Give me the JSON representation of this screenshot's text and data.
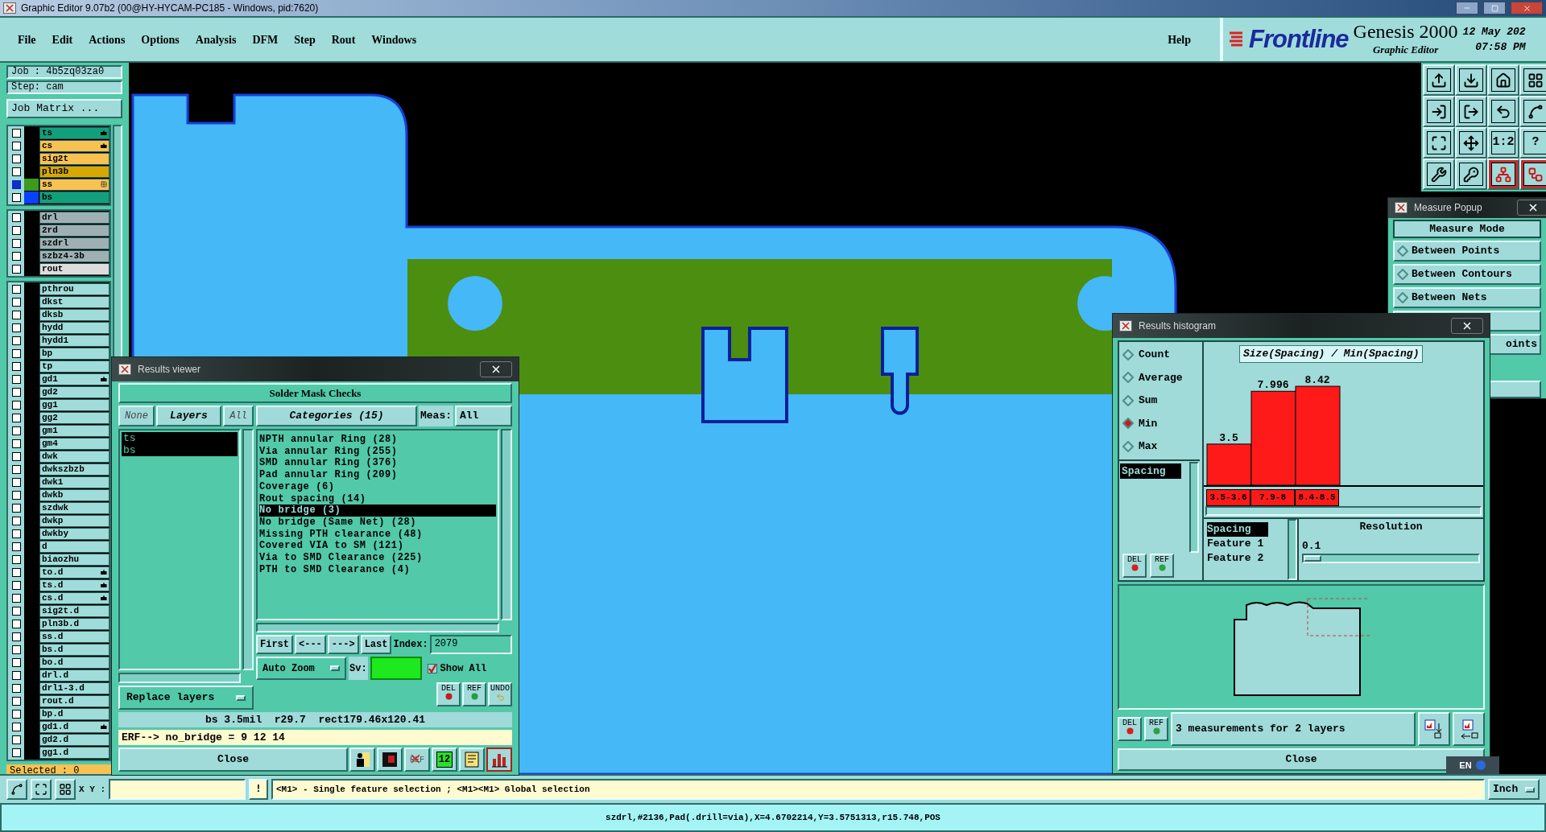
{
  "window": {
    "title": "Graphic Editor 9.07b2 (00@HY-HYCAM-PC185 - Windows, pid:7620)"
  },
  "menu": [
    {
      "label": "File"
    },
    {
      "label": "Edit"
    },
    {
      "label": "Actions"
    },
    {
      "label": "Options"
    },
    {
      "label": "Analysis"
    },
    {
      "label": "DFM"
    },
    {
      "label": "Step"
    },
    {
      "label": "Rout"
    },
    {
      "label": "Windows"
    }
  ],
  "help": "Help",
  "brand": {
    "logo": "Frontline",
    "product": "Genesis 2000",
    "subtitle": "Graphic Editor",
    "date": "12 May 202",
    "time": "07:58 PM"
  },
  "job": {
    "job": "Job : 4b5zq03za0",
    "step": "Step: cam",
    "matrix": "Job Matrix ..."
  },
  "layer_groups": [
    [
      {
        "name": "ts",
        "color": "#12a07c",
        "highlighted": false,
        "edit_mark": true
      },
      {
        "name": "cs",
        "color": "#f7c252",
        "highlighted": false,
        "edit_mark": true
      },
      {
        "name": "sig2t",
        "color": "#f7c252",
        "highlighted": false
      },
      {
        "name": "pln3b",
        "color": "#d9a800",
        "highlighted": false
      },
      {
        "name": "ss",
        "color": "#f7c252",
        "highlighted": true,
        "swatch": {
          "color": "#3c9a1c"
        },
        "grid_mark": true
      },
      {
        "name": "bs",
        "color": "#12a07c",
        "highlighted": false,
        "swatch": {
          "color": "#0a40ff"
        }
      }
    ],
    [
      {
        "name": "drl",
        "color": "#9eb0b4",
        "highlighted": false
      },
      {
        "name": "2rd",
        "color": "#9eb0b4",
        "highlighted": false
      },
      {
        "name": "szdrl",
        "color": "#9eb0b4",
        "highlighted": false
      },
      {
        "name": "szbz4-3b",
        "color": "#9eb0b4",
        "highlighted": false
      },
      {
        "name": "rout",
        "color": "#dcdcdc",
        "highlighted": false
      }
    ],
    [
      {
        "name": "pthrou",
        "color": "#9fdcda",
        "highlighted": false
      },
      {
        "name": "dkst",
        "color": "#9fdcda",
        "highlighted": false
      },
      {
        "name": "dksb",
        "color": "#9fdcda",
        "highlighted": false
      },
      {
        "name": "hydd",
        "color": "#9fdcda",
        "highlighted": false
      },
      {
        "name": "hydd1",
        "color": "#9fdcda",
        "highlighted": false
      },
      {
        "name": "bp",
        "color": "#9fdcda",
        "highlighted": false
      },
      {
        "name": "tp",
        "color": "#9fdcda",
        "highlighted": false
      },
      {
        "name": "gd1",
        "color": "#9fdcda",
        "highlighted": false,
        "edit_mark": true
      },
      {
        "name": "gd2",
        "color": "#9fdcda",
        "highlighted": false
      },
      {
        "name": "gg1",
        "color": "#9fdcda",
        "highlighted": false
      },
      {
        "name": "gg2",
        "color": "#9fdcda",
        "highlighted": false
      },
      {
        "name": "gm1",
        "color": "#9fdcda",
        "highlighted": false
      },
      {
        "name": "gm4",
        "color": "#9fdcda",
        "highlighted": false
      },
      {
        "name": "dwk",
        "color": "#9fdcda",
        "highlighted": false
      },
      {
        "name": "dwkszbzb",
        "color": "#9fdcda",
        "highlighted": false
      },
      {
        "name": "dwk1",
        "color": "#9fdcda",
        "highlighted": false
      },
      {
        "name": "dwkb",
        "color": "#9fdcda",
        "highlighted": false
      },
      {
        "name": "szdwk",
        "color": "#9fdcda",
        "highlighted": false
      },
      {
        "name": "dwkp",
        "color": "#9fdcda",
        "highlighted": false
      },
      {
        "name": "dwkby",
        "color": "#9fdcda",
        "highlighted": false
      },
      {
        "name": "d",
        "color": "#9fdcda",
        "highlighted": false
      },
      {
        "name": "biaozhu",
        "color": "#9fdcda",
        "highlighted": false
      },
      {
        "name": "to.d",
        "color": "#9fdcda",
        "highlighted": false,
        "edit_mark": true
      },
      {
        "name": "ts.d",
        "color": "#9fdcda",
        "highlighted": false,
        "edit_mark": true
      },
      {
        "name": "cs.d",
        "color": "#9fdcda",
        "highlighted": false,
        "edit_mark": true
      },
      {
        "name": "sig2t.d",
        "color": "#9fdcda",
        "highlighted": false
      },
      {
        "name": "pln3b.d",
        "color": "#9fdcda",
        "highlighted": false
      },
      {
        "name": "ss.d",
        "color": "#9fdcda",
        "highlighted": false
      },
      {
        "name": "bs.d",
        "color": "#9fdcda",
        "highlighted": false
      },
      {
        "name": "bo.d",
        "color": "#9fdcda",
        "highlighted": false
      },
      {
        "name": "drl.d",
        "color": "#9fdcda",
        "highlighted": false
      },
      {
        "name": "drl1-3.d",
        "color": "#9fdcda",
        "highlighted": false
      },
      {
        "name": "rout.d",
        "color": "#9fdcda",
        "highlighted": false
      },
      {
        "name": "bp.d",
        "color": "#9fdcda",
        "highlighted": false
      },
      {
        "name": "gd1.d",
        "color": "#9fdcda",
        "highlighted": false,
        "edit_mark": true
      },
      {
        "name": "gd2.d",
        "color": "#9fdcda",
        "highlighted": false
      },
      {
        "name": "gg1.d",
        "color": "#9fdcda",
        "highlighted": false
      }
    ]
  ],
  "selected_count": "Selected : 0",
  "toolbar": [
    {
      "selected": false
    },
    {
      "selected": false
    },
    {
      "selected": false
    },
    {
      "selected": false
    },
    {
      "selected": false
    },
    {
      "selected": false
    },
    {
      "selected": false
    },
    {
      "selected": false
    },
    {
      "selected": false
    },
    {
      "selected": false
    },
    {
      "selected": false,
      "label": "1:2"
    },
    {
      "selected": false,
      "label": "?"
    },
    {
      "selected": false
    },
    {
      "selected": false
    },
    {
      "selected": true
    },
    {
      "selected": true
    }
  ],
  "results_viewer": {
    "title": "Results viewer",
    "heading": "Solder Mask Checks",
    "none": "None",
    "layers_header": "Layers",
    "all": "All",
    "layers": [
      {
        "name": "ts",
        "selected": true
      },
      {
        "name": "bs",
        "selected": true
      }
    ],
    "categories_header": "Categories (15)",
    "meas_label": "Meas:",
    "meas_value": "All",
    "categories": [
      {
        "label": "NPTH annular Ring (28)",
        "selected": false
      },
      {
        "label": "Via annular Ring (255)",
        "selected": false
      },
      {
        "label": "SMD annular Ring (376)",
        "selected": false
      },
      {
        "label": "Pad annular Ring (209)",
        "selected": false
      },
      {
        "label": "Coverage (6)",
        "selected": false
      },
      {
        "label": "Rout spacing (14)",
        "selected": false
      },
      {
        "label": "No bridge (3)",
        "selected": true
      },
      {
        "label": "No bridge (Same Net) (28)",
        "selected": false
      },
      {
        "label": "Missing PTH clearance (48)",
        "selected": false
      },
      {
        "label": "Covered VIA to SM (121)",
        "selected": false
      },
      {
        "label": "Via to SMD Clearance (225)",
        "selected": false
      },
      {
        "label": "PTH to SMD Clearance (4)",
        "selected": false
      }
    ],
    "nav": [
      "First",
      "<---",
      "--->",
      "Last"
    ],
    "index_label": "Index:",
    "index_value": "2079",
    "zoom": "Auto Zoom",
    "sv_label": "Sv:",
    "sv_swatch": {
      "color": "#1ee81e"
    },
    "show_all": {
      "label": "Show All",
      "checked": true
    },
    "replace": "Replace layers",
    "actions": [
      {
        "label": "DEL",
        "color": "#c02020"
      },
      {
        "label": "REF",
        "color": "#20a040"
      },
      {
        "label": "UNDO"
      }
    ],
    "measure_line": "bs 3.5mil  r29.7  rect179.46x120.41",
    "erf": "ERF--> no_bridge = 9 12 14",
    "close": "Close",
    "tools": [
      {
        "kind": "figure",
        "selected": false
      },
      {
        "kind": "monitor",
        "selected": false
      },
      {
        "kind": "crossed",
        "label": "REF",
        "selected": false
      },
      {
        "kind": "counter",
        "label": "12",
        "selected": false
      },
      {
        "kind": "notes",
        "selected": false
      },
      {
        "kind": "chart",
        "selected": true
      }
    ]
  },
  "histogram": {
    "title": "Results histogram",
    "modes": [
      {
        "label": "Count",
        "selected": false
      },
      {
        "label": "Average",
        "selected": false
      },
      {
        "label": "Sum",
        "selected": false
      },
      {
        "label": "Min",
        "selected": true
      },
      {
        "label": "Max",
        "selected": false
      }
    ],
    "attributes": [
      {
        "label": "Spacing",
        "selected": true
      }
    ],
    "list_buttons": [
      {
        "label": "DEL",
        "color": "#d42020"
      },
      {
        "label": "REF",
        "color": "#30a040"
      }
    ],
    "chart_data": {
      "type": "bar",
      "title": "Size(Spacing) / Min(Spacing)",
      "categories": [
        "3.5-3.6",
        "7.9-8",
        "8.4-8.5"
      ],
      "series": [
        {
          "color": "#ff1a1a",
          "values": [
            3.5,
            7.996,
            8.42
          ]
        }
      ],
      "data_labels": true
    },
    "fields": [
      {
        "label": "Spacing",
        "selected": true
      },
      {
        "label": "Feature 1",
        "selected": false
      },
      {
        "label": "Feature 2",
        "selected": false
      }
    ],
    "resolution": {
      "label": "Resolution",
      "value": "0.1",
      "level": 0.06
    },
    "bottom_buttons": [
      {
        "label": "DEL",
        "color": "#d42020"
      },
      {
        "label": "REF",
        "color": "#30a040"
      }
    ],
    "summary": "3 measurements for 2 layers",
    "close": "Close"
  },
  "measure_popup": {
    "title": "Measure Popup",
    "heading": "Measure Mode",
    "modes": [
      {
        "label": "Between Points",
        "selected": false
      },
      {
        "label": "Between Contours",
        "selected": false
      },
      {
        "label": "Between Nets",
        "selected": false
      }
    ],
    "partial_mode": "oints"
  },
  "language_bar": {
    "label": "EN"
  },
  "status": {
    "xy_label": "X Y :",
    "bang": "!",
    "message": "<M1> - Single feature selection ; <M1><M1> Global selection",
    "units": "Inch"
  },
  "info_line": "szdrl,#2136,Pad(.drill=via),X=4.6702214,Y=3.5751313,r15.748,POS"
}
